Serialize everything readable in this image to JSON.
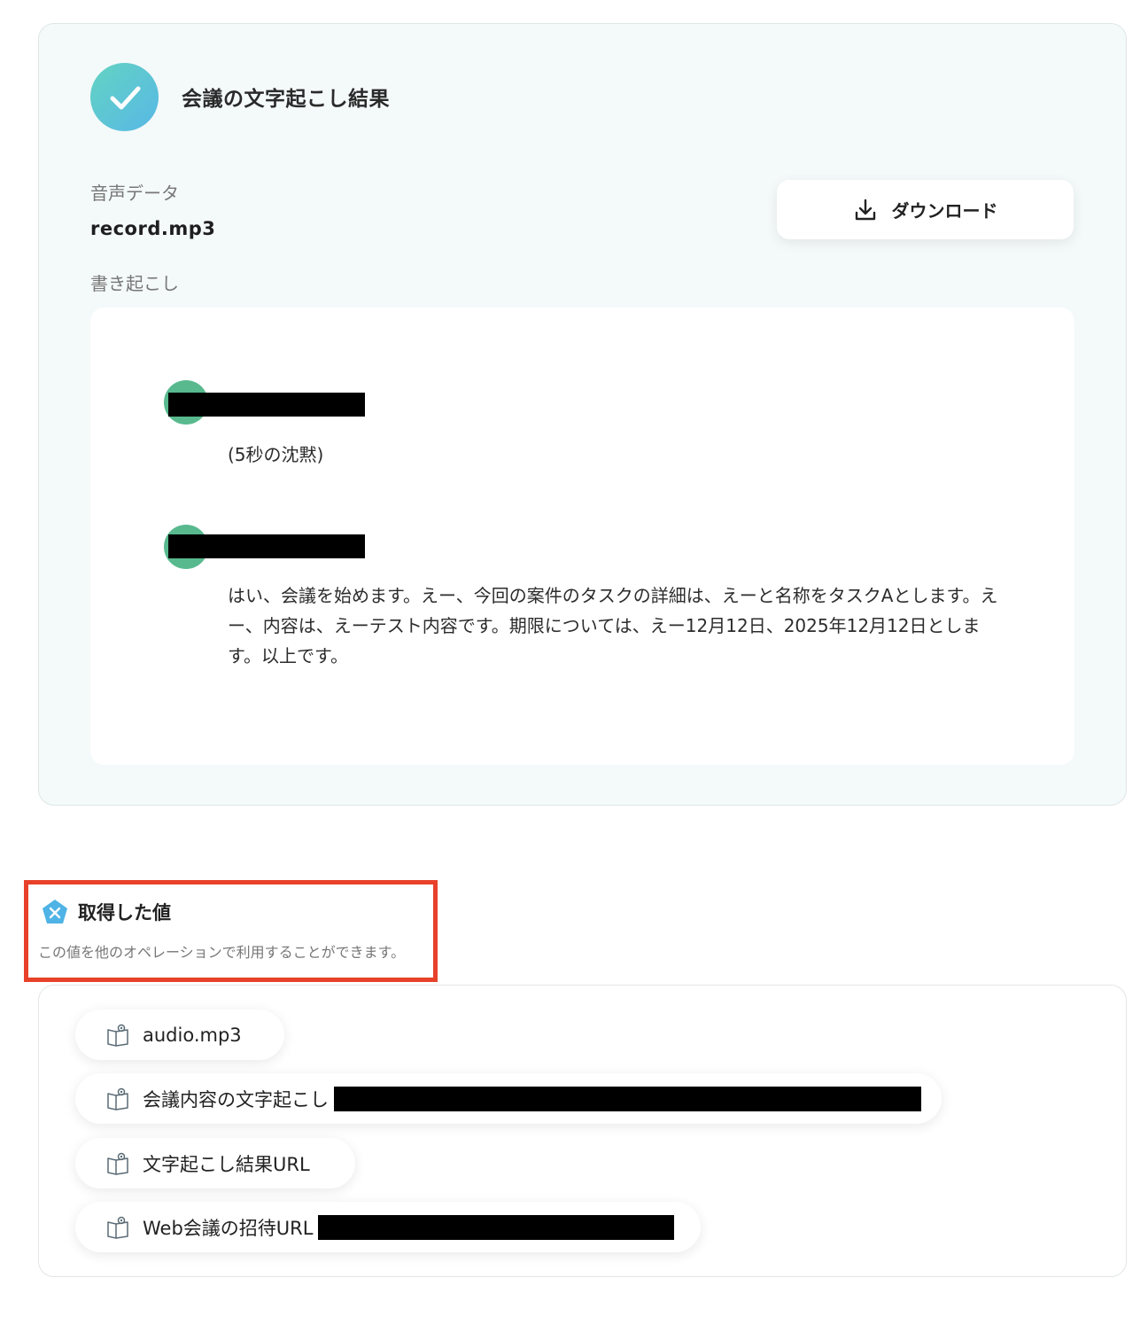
{
  "result": {
    "title": "会議の文字起こし結果",
    "audio_label": "音声データ",
    "audio_filename": "record.mp3",
    "download_label": "ダウンロード",
    "transcript_label": "書き起こし"
  },
  "transcript": {
    "entries": [
      {
        "text": "(5秒の沈黙)"
      },
      {
        "text": "はい、会議を始めます。えー、今回の案件のタスクの詳細は、えーと名称をタスクAとします。えー、内容は、えーテスト内容です。期限については、えー12月12日、2025年12月12日とします。以上です。"
      }
    ]
  },
  "values": {
    "title": "取得した値",
    "description": "この値を他のオペレーションで利用することができます。",
    "items": [
      {
        "label": "audio.mp3"
      },
      {
        "label": "会議内容の文字起こし"
      },
      {
        "label": "文字起こし結果URL"
      },
      {
        "label": "Web会議の招待URL"
      }
    ]
  },
  "colors": {
    "accent_gradient_start": "#63d3c2",
    "accent_gradient_end": "#58b8e6",
    "speaker_avatar": "#58b98e",
    "highlight_border": "#e8412a"
  },
  "icons": [
    "check-icon",
    "download-icon",
    "variable-icon",
    "book-icon"
  ]
}
